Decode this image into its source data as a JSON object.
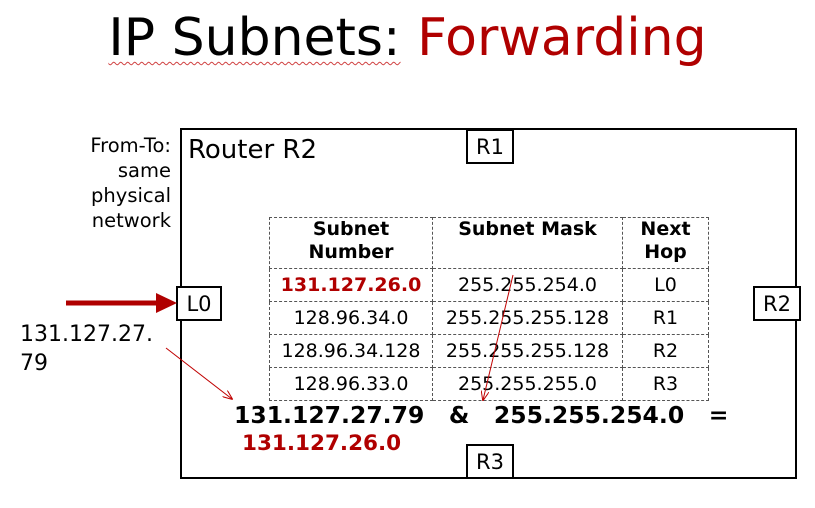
{
  "title": {
    "main": "IP Subnets:",
    "accent": "Forwarding"
  },
  "router": {
    "label": "Router R2",
    "ports": {
      "r1": "R1",
      "r2": "R2",
      "r3": "R3",
      "l0": "L0"
    }
  },
  "note_lines": [
    "From-To:",
    "same",
    "physical",
    "network"
  ],
  "incoming_ip": {
    "line1": "131.127.27.",
    "line2": "79"
  },
  "table": {
    "headers": [
      {
        "line1": "Subnet",
        "line2": "Number"
      },
      {
        "line1": "Subnet Mask",
        "line2": ""
      },
      {
        "line1": "Next",
        "line2": "Hop"
      }
    ],
    "rows": [
      {
        "subnet": "131.127.26.0",
        "mask": "255.255.254.0",
        "hop": "L0"
      },
      {
        "subnet": "128.96.34.0",
        "mask": "255.255.255.128",
        "hop": "R1"
      },
      {
        "subnet": "128.96.34.128",
        "mask": "255.255.255.128",
        "hop": "R2"
      },
      {
        "subnet": "128.96.33.0",
        "mask": "255.255.255.0",
        "hop": "R3"
      }
    ]
  },
  "equation": {
    "ip": "131.127.27.79",
    "op": "&",
    "mask": "255.255.254.0",
    "eq": "="
  },
  "result": "131.127.26.0",
  "colors": {
    "accent": "#b00000",
    "arrow_thick": "#b00000",
    "arrow_thin": "#c00000"
  }
}
